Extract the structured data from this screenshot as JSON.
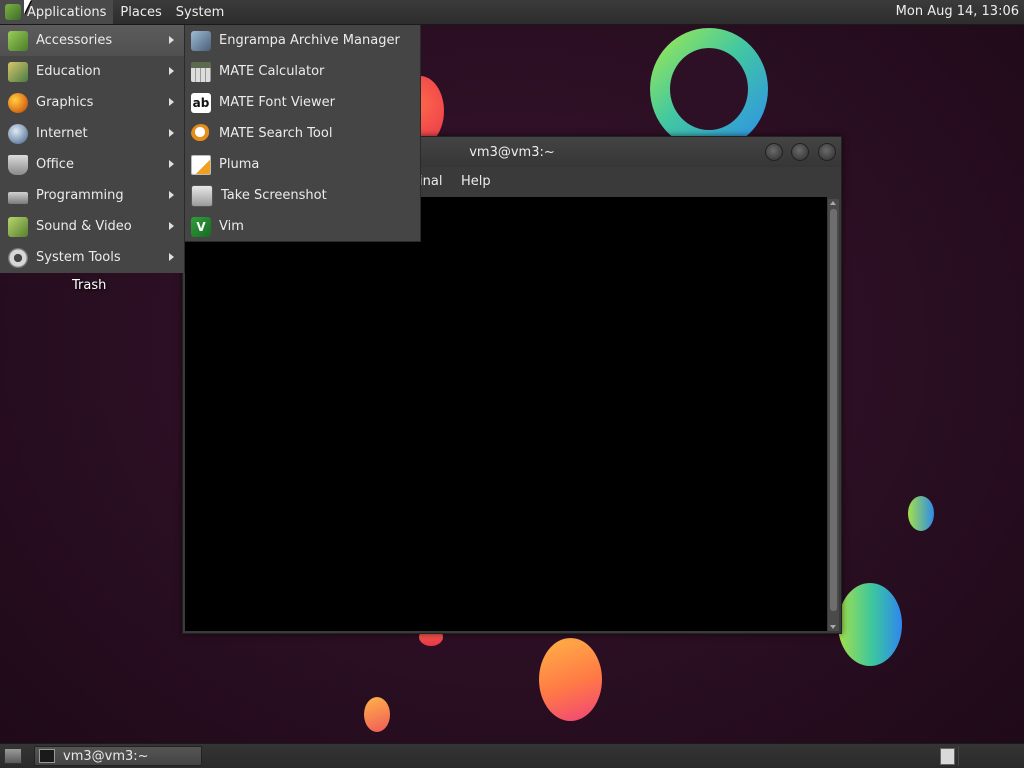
{
  "top_panel": {
    "menus": [
      "Applications",
      "Places",
      "System"
    ],
    "clock": "Mon Aug 14, 13:06"
  },
  "app_menu": {
    "categories": [
      {
        "label": "Accessories",
        "icon": "accessories-icon"
      },
      {
        "label": "Education",
        "icon": "education-icon"
      },
      {
        "label": "Graphics",
        "icon": "graphics-icon"
      },
      {
        "label": "Internet",
        "icon": "internet-icon"
      },
      {
        "label": "Office",
        "icon": "office-icon"
      },
      {
        "label": "Programming",
        "icon": "programming-icon"
      },
      {
        "label": "Sound & Video",
        "icon": "sound-video-icon"
      },
      {
        "label": "System Tools",
        "icon": "system-tools-icon"
      }
    ],
    "accessories_submenu": [
      {
        "label": "Engrampa Archive Manager",
        "icon": "archive-manager-icon"
      },
      {
        "label": "MATE Calculator",
        "icon": "calculator-icon"
      },
      {
        "label": "MATE Font Viewer",
        "icon": "font-viewer-icon"
      },
      {
        "label": "MATE Search Tool",
        "icon": "search-tool-icon"
      },
      {
        "label": "Pluma",
        "icon": "text-editor-icon"
      },
      {
        "label": "Take Screenshot",
        "icon": "screenshot-icon"
      },
      {
        "label": "Vim",
        "icon": "vim-icon"
      }
    ],
    "font_viewer_glyph": "ab",
    "vim_glyph": "V"
  },
  "desktop": {
    "trash_label": "Trash"
  },
  "terminal_window": {
    "title": "vm3@vm3:~",
    "menubar_partial": "inal",
    "menubar_help": "Help"
  },
  "bottom_panel": {
    "task_label": "vm3@vm3:~"
  },
  "colors": {
    "desktop_bg": "#2a0e22",
    "panel_bg": "#2d2d2d",
    "menu_bg": "#454545",
    "menu_highlight": "#5c5c5c"
  }
}
